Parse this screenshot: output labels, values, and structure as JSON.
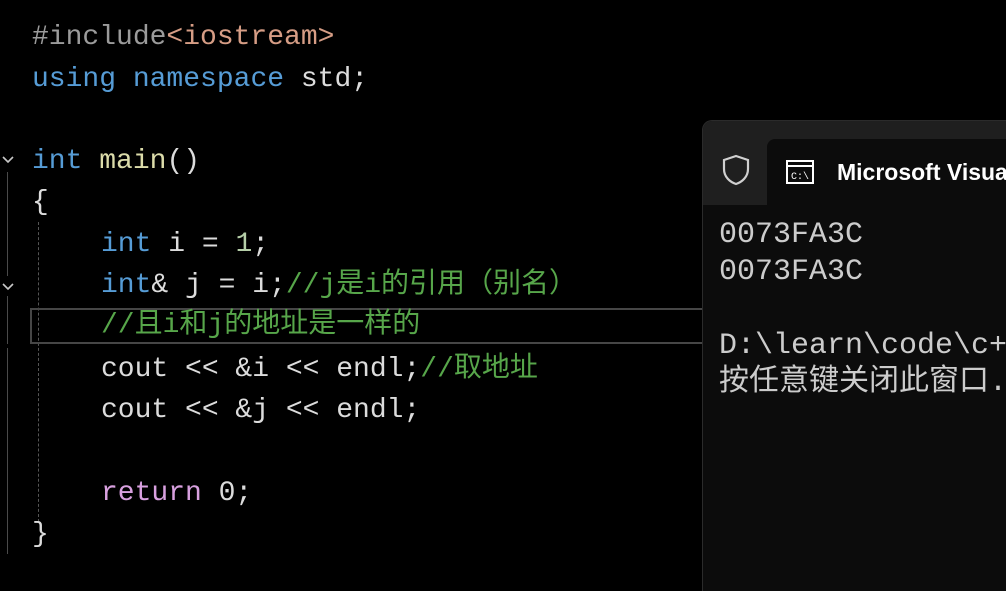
{
  "editor": {
    "lines": {
      "l1": {
        "hash_include": "#include",
        "header": "<iostream>"
      },
      "l2": {
        "using": "using",
        "namespace": "namespace",
        "rest": " std;"
      },
      "l4": {
        "type": "int",
        "name": "main",
        "parens": "()"
      },
      "l5": {
        "brace": "{"
      },
      "l6": {
        "type": "int",
        "rest": " i = ",
        "num": "1",
        "semi": ";"
      },
      "l7": {
        "type": "int",
        "rest": "& j = i;",
        "comment": "//j是i的引用（别名）"
      },
      "l8": {
        "comment": "//且i和j的地址是一样的"
      },
      "l9": {
        "code": "cout << &i << endl;",
        "comment": "//取地址"
      },
      "l10": {
        "code": "cout << &j << endl;"
      },
      "l12": {
        "ret": "return",
        "rest": " 0;"
      },
      "l13": {
        "brace": "}"
      }
    }
  },
  "terminal": {
    "tab_title": "Microsoft Visual Studio 调试控制台",
    "output": [
      "0073FA3C",
      "0073FA3C",
      "",
      "D:\\learn\\code\\c++\\test\\Debug\\test.exe",
      "按任意键关闭此窗口. . ."
    ],
    "icons": {
      "shield": "shield-icon",
      "cmd": "cmd-icon"
    }
  },
  "colors": {
    "keyword": "#569cd6",
    "function": "#dcdcaa",
    "comment": "#57a64a",
    "include": "#d69d85",
    "return": "#d8a0df"
  }
}
